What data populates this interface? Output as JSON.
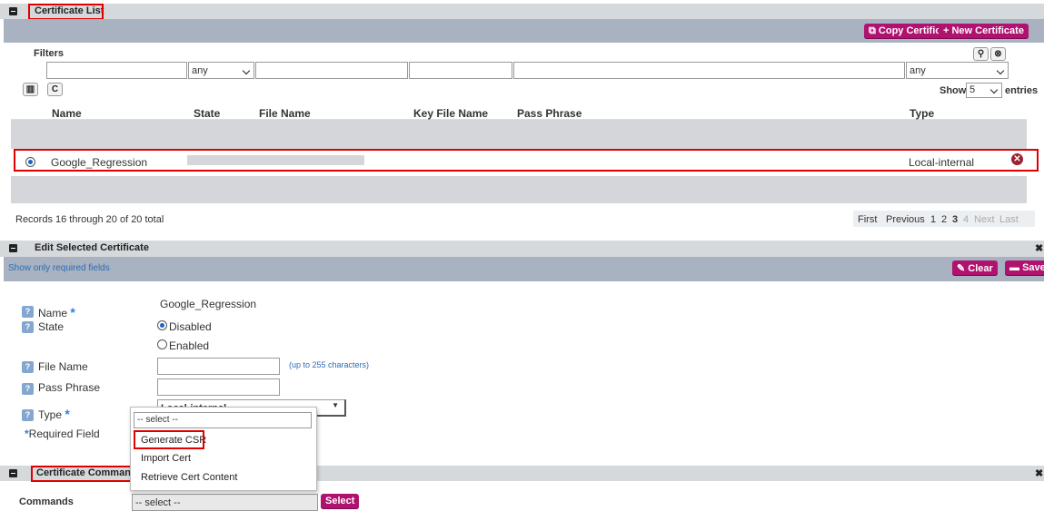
{
  "cert_list": {
    "title": "Certificate List",
    "copy_btn": "Copy Certificate",
    "new_btn": "+ New Certificate",
    "filters_label": "Filters",
    "filter_state": "any",
    "filter_type": "any",
    "show_label": "Show",
    "show_value": "5",
    "entries_label": "entries",
    "columns": {
      "name": "Name",
      "state": "State",
      "file_name": "File Name",
      "key_file_name": "Key File Name",
      "pass_phrase": "Pass Phrase",
      "type": "Type"
    },
    "row": {
      "name": "Google_Regression",
      "type": "Local-internal"
    },
    "records_text": "Records 16 through 20 of 20 total",
    "pager": {
      "first": "First",
      "previous": "Previous",
      "p1": "1",
      "p2": "2",
      "p3": "3",
      "p4": "4",
      "next": "Next",
      "last": "Last"
    }
  },
  "edit": {
    "title": "Edit Selected Certificate",
    "required_link": "Show only required fields",
    "clear_btn": "Clear",
    "save_btn": "Save",
    "name_label": "Name",
    "name_value": "Google_Regression",
    "state_label": "State",
    "state_disabled": "Disabled",
    "state_enabled": "Enabled",
    "file_name_label": "File Name",
    "file_hint": "(up to 255 characters)",
    "pass_label": "Pass Phrase",
    "type_label": "Type",
    "type_value": "Local-internal",
    "required_note": "Required Field"
  },
  "dropdown": {
    "search_value": "-- select --",
    "items": [
      "Generate CSR",
      "Import Cert",
      "Retrieve Cert Content"
    ]
  },
  "commands": {
    "title": "Certificate Commands",
    "label": "Commands",
    "select_value": "-- select --",
    "select_btn": "Select"
  },
  "colors": {
    "accent": "#b0126f",
    "bar": "#a8b2c0",
    "highlight": "#e00000"
  }
}
